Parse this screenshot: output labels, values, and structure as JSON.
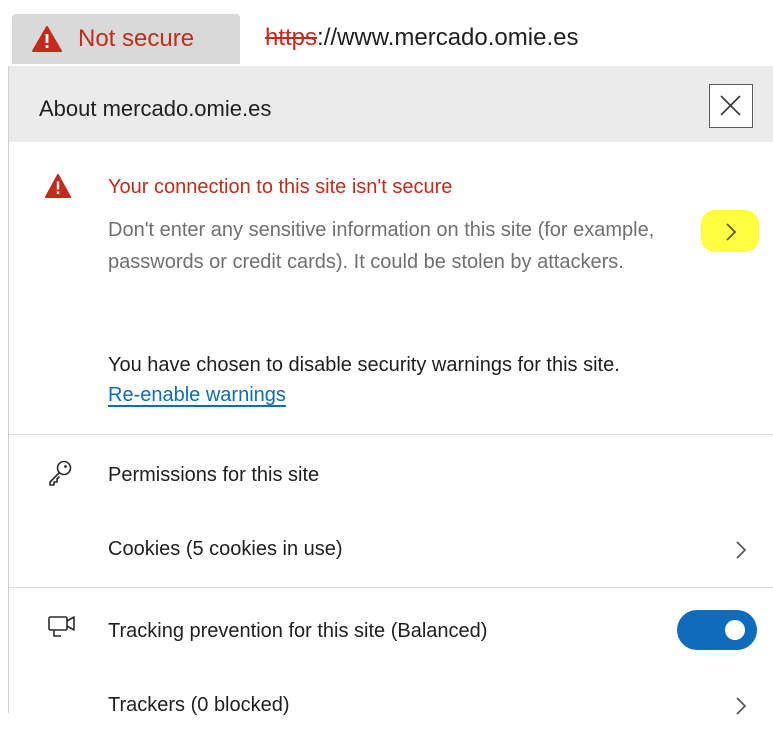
{
  "address_bar": {
    "security_chip_label": "Not secure",
    "url_scheme": "https",
    "url_rest": "://www.mercado.omie.es"
  },
  "flyout": {
    "title": "About mercado.omie.es",
    "connection": {
      "title": "Your connection to this site isn't secure",
      "description": "Don't enter any sensitive information on this site (for example, passwords or credit cards). It could be stolen by attackers.",
      "disabled_note": "You have chosen to disable security warnings for this site.",
      "reenable_link": "Re-enable warnings"
    },
    "permissions": {
      "title": "Permissions for this site",
      "cookies_label": "Cookies (5 cookies in use)"
    },
    "tracking": {
      "label": "Tracking prevention for this site (Balanced)",
      "toggle_on": true,
      "trackers_label": "Trackers (0 blocked)"
    }
  },
  "colors": {
    "warning_red": "#c42b1c",
    "link_blue": "#0f6cbd",
    "toggle_blue": "#0f6cbd",
    "highlight_yellow": "#ffff40",
    "header_gray": "#ebebeb"
  },
  "icons": {
    "warning": "warning-triangle-icon",
    "close": "close-icon",
    "chevron": "chevron-right-icon",
    "permissions": "key-icon",
    "tracking": "tracking-prevention-icon"
  }
}
